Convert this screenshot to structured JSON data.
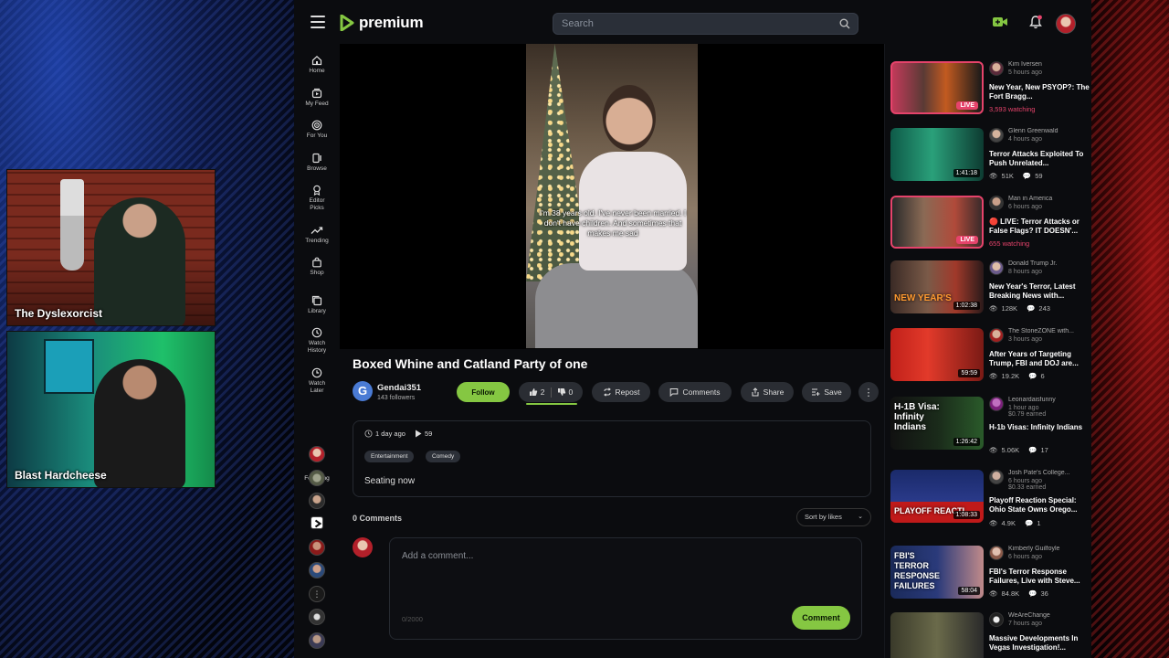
{
  "stream": {
    "cam1_name": "The Dyslexorcist",
    "cam2_name": "Blast Hardcheese"
  },
  "app": {
    "logo_text": "premium",
    "brand_color": "#85c742",
    "search_placeholder": "Search"
  },
  "nav": {
    "items": [
      {
        "label": "Home",
        "icon": "home-icon"
      },
      {
        "label": "My Feed",
        "icon": "feed-icon"
      },
      {
        "label": "For You",
        "icon": "target-icon"
      },
      {
        "label": "Browse",
        "icon": "browse-icon"
      },
      {
        "label": "Editor Picks",
        "icon": "award-icon"
      },
      {
        "label": "Trending",
        "icon": "trending-icon"
      },
      {
        "label": "Shop",
        "icon": "shop-icon"
      },
      {
        "label": "Library",
        "icon": "library-icon"
      },
      {
        "label": "Watch History",
        "icon": "history-icon"
      },
      {
        "label": "Watch Later",
        "icon": "clock-icon"
      }
    ],
    "following_label": "Following"
  },
  "video": {
    "caption": "I'm 38 years old. I've never been married. I don't have children. And sometimes that makes me sad",
    "title": "Boxed Whine and Catland Party of one",
    "channel_initial": "G",
    "channel_name": "Gendai351",
    "followers": "143 followers",
    "follow_label": "Follow",
    "likes": "2",
    "dislikes": "0",
    "repost_label": "Repost",
    "comments_label": "Comments",
    "share_label": "Share",
    "save_label": "Save",
    "posted": "1 day ago",
    "views": "59",
    "tags": [
      "Entertainment",
      "Comedy"
    ],
    "description": "Seating now"
  },
  "comments": {
    "count_label": "0 Comments",
    "sort_label": "Sort by likes",
    "placeholder": "Add a comment...",
    "char_count": "0/2000",
    "submit_label": "Comment"
  },
  "sidebar": {
    "items": [
      {
        "channel": "Kim Iversen",
        "time": "5 hours ago",
        "title": "New Year, New PSYOP?: The Fort Bragg...",
        "live": true,
        "watching": "3,593 watching",
        "duration": "LIVE",
        "thumb_text": ""
      },
      {
        "channel": "Glenn Greenwald",
        "time": "4 hours ago",
        "title": "Terror Attacks Exploited To Push Unrelated...",
        "live": false,
        "views": "51K",
        "comments": "59",
        "duration": "1:41:18",
        "thumb_text": ""
      },
      {
        "channel": "Man in America",
        "time": "6 hours ago",
        "title": "🔴 LIVE: Terror Attacks or False Flags? IT DOESN'...",
        "live": true,
        "watching": "655 watching",
        "duration": "LIVE",
        "thumb_text": ""
      },
      {
        "channel": "Donald Trump Jr.",
        "time": "8 hours ago",
        "title": "New Year's Terror, Latest Breaking News with...",
        "live": false,
        "views": "128K",
        "comments": "243",
        "duration": "1:02:38",
        "thumb_text": "NEW YEAR'S"
      },
      {
        "channel": "The StoneZONE with...",
        "time": "3 hours ago",
        "title": "After Years of Targeting Trump, FBI and DOJ are...",
        "live": false,
        "views": "19.2K",
        "comments": "6",
        "duration": "59:59",
        "thumb_text": ""
      },
      {
        "channel": "Leonardaisfunny",
        "time": "1 hour ago",
        "earned": "$0.79 earned",
        "title": "H-1b Visas: Infinity Indians",
        "live": false,
        "views": "5.06K",
        "comments": "17",
        "duration": "1:26:42",
        "thumb_text": "H-1B Visa: Infinity Indians"
      },
      {
        "channel": "Josh Pate's College...",
        "time": "6 hours ago",
        "earned": "$0.33 earned",
        "title": "Playoff Reaction Special: Ohio State Owns Orego...",
        "live": false,
        "views": "4.9K",
        "comments": "1",
        "duration": "1:08:33",
        "thumb_text": "PLAYOFF REACTI"
      },
      {
        "channel": "Kimberly Guilfoyle",
        "time": "6 hours ago",
        "title": "FBI's Terror Response Failures, Live with Steve...",
        "live": false,
        "views": "84.8K",
        "comments": "36",
        "duration": "58:04",
        "thumb_text": "FBI'S TERROR RESPONSE FAILURES"
      },
      {
        "channel": "WeAreChange",
        "time": "7 hours ago",
        "title": "Massive Developments In Vegas Investigation!...",
        "live": false,
        "views": "",
        "comments": "",
        "duration": "",
        "thumb_text": ""
      }
    ]
  }
}
